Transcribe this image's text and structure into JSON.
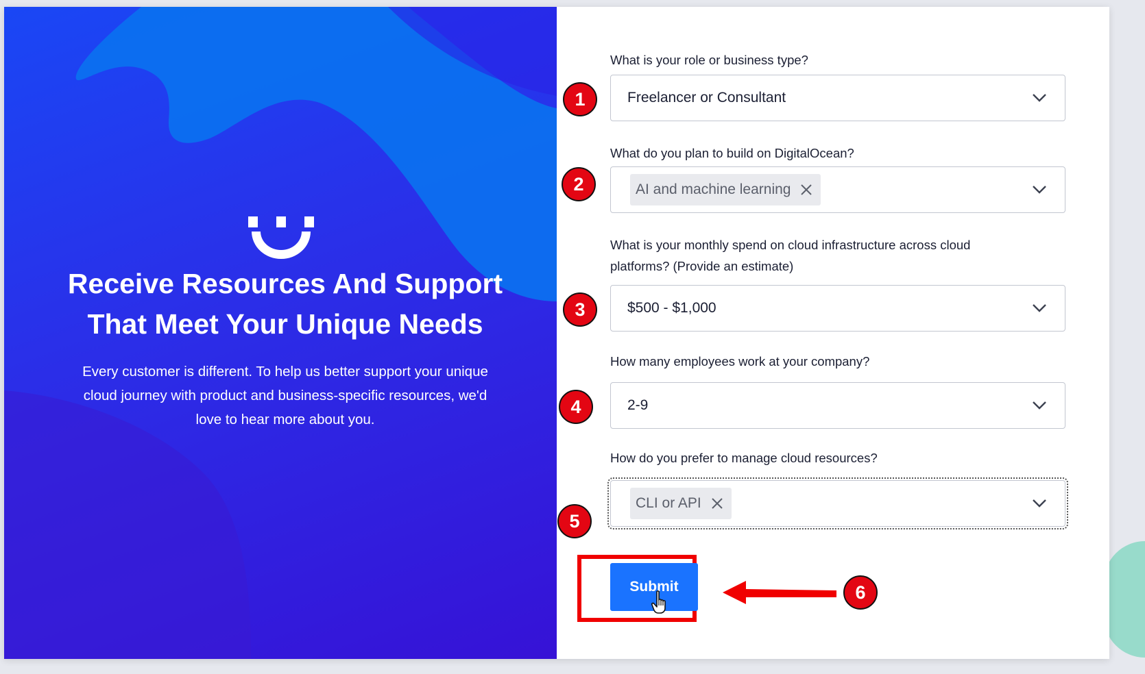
{
  "left": {
    "headline_line1": "Receive Resources And Support",
    "headline_line2": "That Meet Your Unique Needs",
    "description_lines": [
      "Every customer is different. To help us better support your unique",
      "cloud journey with product and business-specific resources, we'd",
      "love to hear more about you."
    ]
  },
  "form": {
    "role": {
      "label": "What is your role or business type?",
      "value": "Freelancer or Consultant"
    },
    "build": {
      "label": "What do you plan to build on DigitalOcean?",
      "chip": "AI and machine learning"
    },
    "spend": {
      "label_line1": "What is your monthly spend on cloud infrastructure across cloud",
      "label_line2": "platforms? (Provide an estimate)",
      "value": "$500 - $1,000"
    },
    "employees": {
      "label": "How many employees work at your company?",
      "value": "2-9"
    },
    "manage": {
      "label": "How do you prefer to manage cloud resources?",
      "chip": "CLI or API"
    },
    "submit_label": "Submit"
  },
  "annotations": {
    "badges": [
      "1",
      "2",
      "3",
      "4",
      "5",
      "6"
    ],
    "badge_color": "#e30613",
    "highlight_color": "#f00000"
  },
  "colors": {
    "brand_blue": "#1a73ff",
    "panel_gradient_start": "#1a47f5",
    "panel_gradient_end": "#3612d6"
  }
}
